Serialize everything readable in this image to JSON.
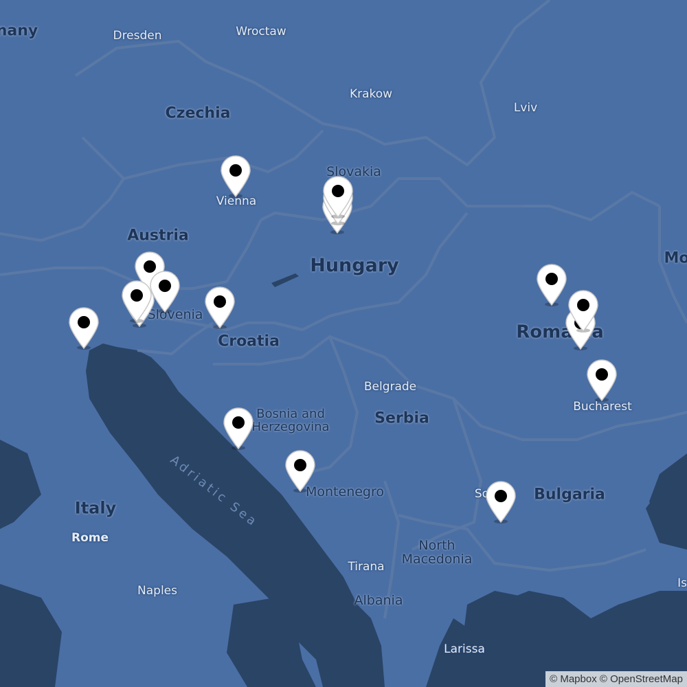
{
  "map": {
    "labels": {
      "germany": "nany",
      "dresden": "Dresden",
      "wroclaw": "Wroctaw",
      "krakow": "Krakow",
      "lviv": "Lviv",
      "czechia": "Czechia",
      "slovakia": "Slovakia",
      "vienna": "Vienna",
      "austria": "Austria",
      "hungary": "Hungary",
      "slovenia": "Slovenia",
      "croatia": "Croatia",
      "romania": "Romania",
      "moldova": "Mo",
      "belgrade": "Belgrade",
      "serbia": "Serbia",
      "bosnia": "Bosnia and Herzegovina",
      "bucharest": "Bucharest",
      "bulgaria": "Bulgaria",
      "sofia": "Sofia",
      "montenegro": "Montenegro",
      "italy": "Italy",
      "rome": "Rome",
      "adriatic": "Adriatic Sea",
      "north_macedonia": "North Macedonia",
      "tirana": "Tirana",
      "albania": "Albania",
      "naples": "Naples",
      "larissa": "Larissa",
      "istanbul": "Is"
    },
    "markers_count": 17,
    "attribution": "© Mapbox © OpenStreetMap"
  },
  "colors": {
    "land": "#4a6fa5",
    "sea": "#2a4466",
    "border": "#5c7aa5",
    "pin_fill": "#ffffff",
    "pin_dot": "#000000"
  }
}
